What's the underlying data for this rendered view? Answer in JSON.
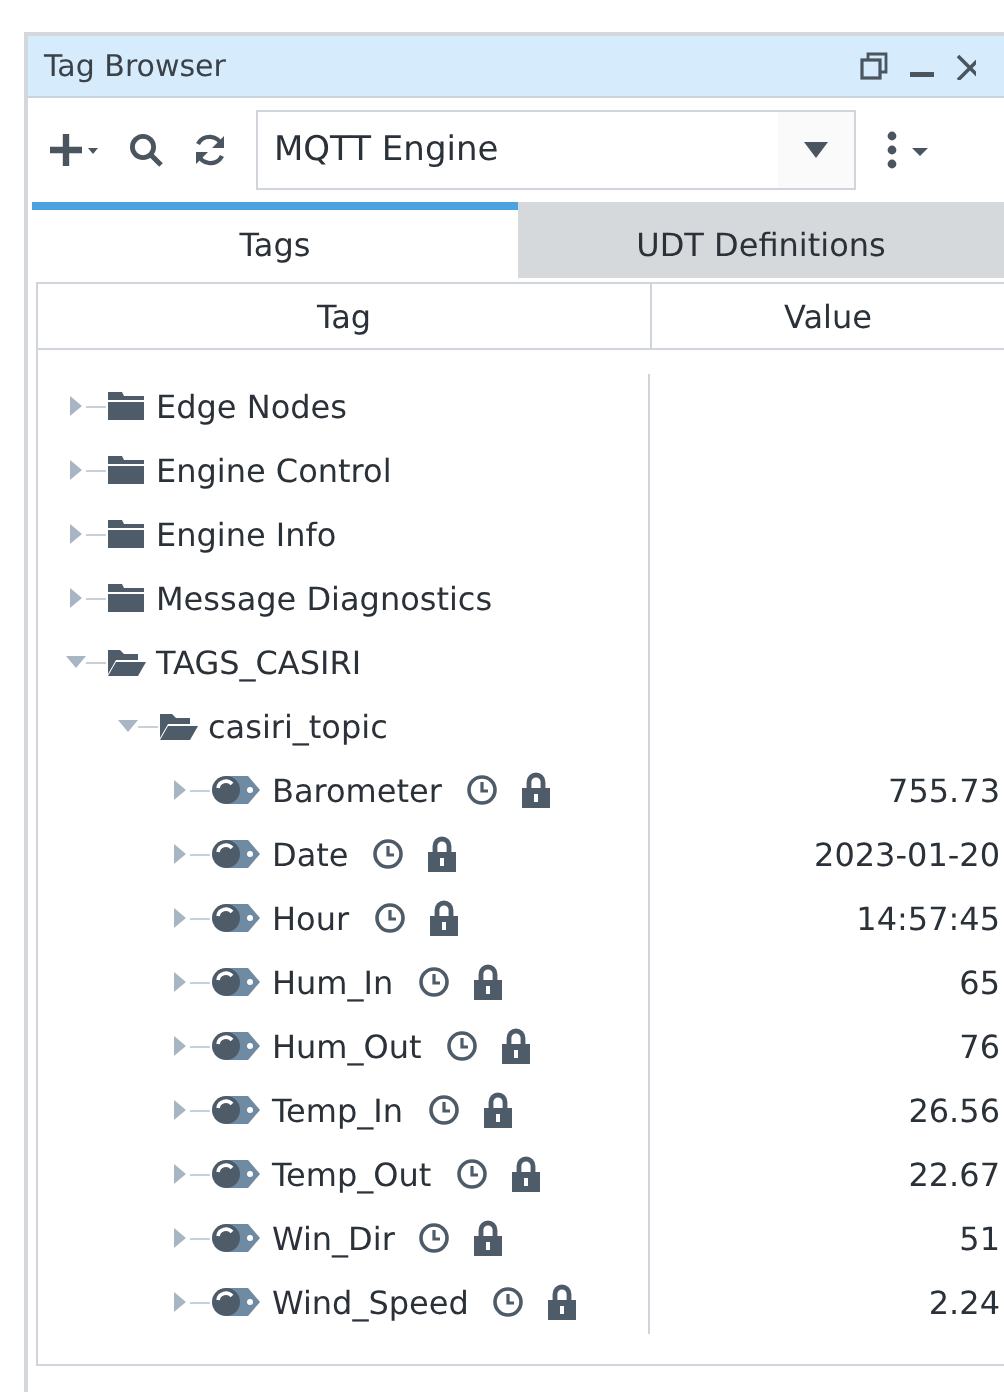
{
  "window": {
    "title": "Tag Browser"
  },
  "toolbar": {
    "provider": "MQTT Engine"
  },
  "tabs": [
    {
      "label": "Tags",
      "selected": true
    },
    {
      "label": "UDT Definitions",
      "selected": false
    }
  ],
  "table": {
    "columns": [
      "Tag",
      "Value"
    ],
    "tree": [
      {
        "kind": "folder",
        "name": "Edge Nodes",
        "expanded": false
      },
      {
        "kind": "folder",
        "name": "Engine Control",
        "expanded": false
      },
      {
        "kind": "folder",
        "name": "Engine Info",
        "expanded": false
      },
      {
        "kind": "folder",
        "name": "Message Diagnostics",
        "expanded": false
      },
      {
        "kind": "folder",
        "name": "TAGS_CASIRI",
        "expanded": true,
        "children": [
          {
            "kind": "folder",
            "name": "casiri_topic",
            "expanded": true,
            "children": [
              {
                "kind": "tag",
                "name": "Barometer",
                "value": "755.73",
                "expanded": false
              },
              {
                "kind": "tag",
                "name": "Date",
                "value": "2023-01-20",
                "expanded": false
              },
              {
                "kind": "tag",
                "name": "Hour",
                "value": "14:57:45",
                "expanded": false
              },
              {
                "kind": "tag",
                "name": "Hum_In",
                "value": "65",
                "expanded": false
              },
              {
                "kind": "tag",
                "name": "Hum_Out",
                "value": "76",
                "expanded": false
              },
              {
                "kind": "tag",
                "name": "Temp_In",
                "value": "26.56",
                "expanded": false
              },
              {
                "kind": "tag",
                "name": "Temp_Out",
                "value": "22.67",
                "expanded": false
              },
              {
                "kind": "tag",
                "name": "Win_Dir",
                "value": "51",
                "expanded": false
              },
              {
                "kind": "tag",
                "name": "Wind_Speed",
                "value": "2.24",
                "expanded": false
              }
            ]
          }
        ]
      }
    ]
  }
}
